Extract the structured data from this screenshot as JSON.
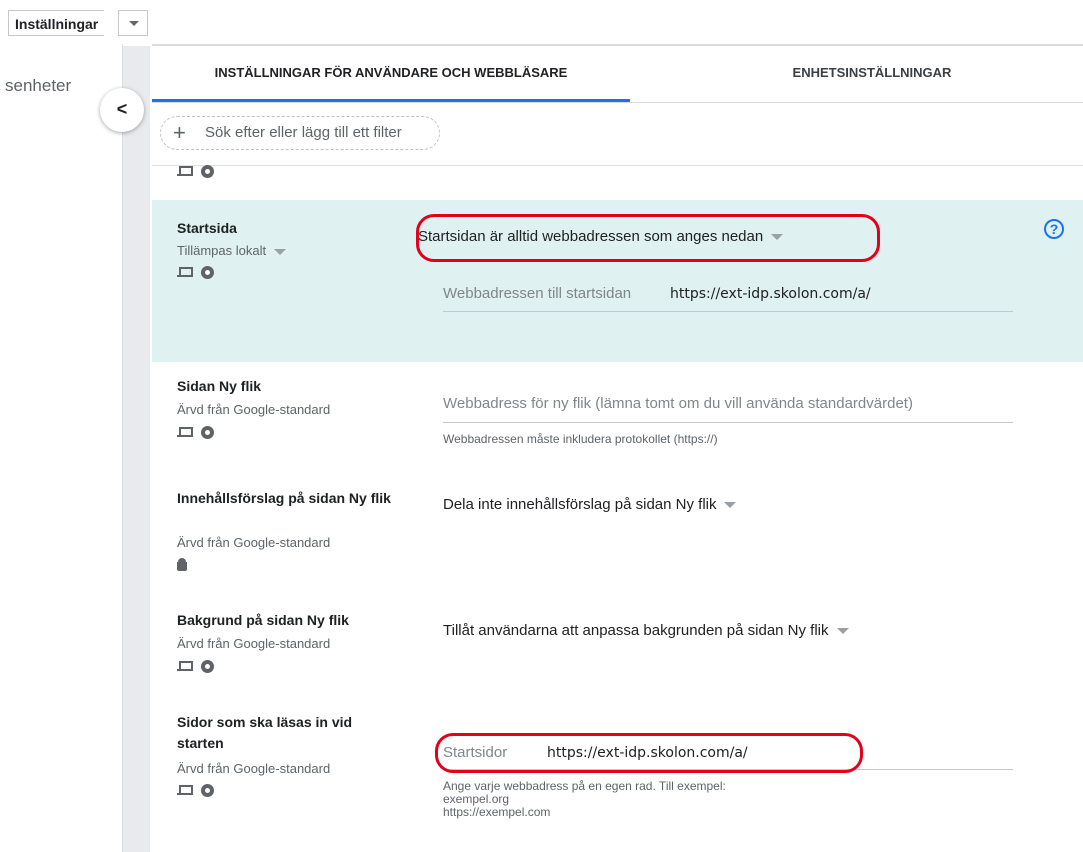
{
  "topbar": {
    "settings_label": "Inställningar"
  },
  "left_rail": {
    "partial_label": "senheter"
  },
  "tabs": [
    {
      "label": "INSTÄLLNINGAR FÖR ANVÄNDARE OCH WEBBLÄSARE",
      "active": true
    },
    {
      "label": "ENHETSINSTÄLLNINGAR",
      "active": false
    }
  ],
  "filter": {
    "placeholder": "Sök efter eller lägg till ett filter"
  },
  "settings": {
    "startsida": {
      "title": "Startsida",
      "source": "Tillämpas lokalt",
      "value": "Startsidan är alltid webbadressen som anges nedan",
      "field_label": "Webbadressen till startsidan",
      "field_value": "https://ext-idp.skolon.com/a/"
    },
    "new_tab": {
      "title": "Sidan Ny flik",
      "source": "Ärvd från Google-standard",
      "placeholder": "Webbadress för ny flik (lämna tomt om du vill använda standardvärdet)",
      "helper": "Webbadressen måste inkludera protokollet (https://)"
    },
    "content_suggestions": {
      "title": "Innehållsförslag på sidan Ny flik",
      "source": "Ärvd från Google-standard",
      "value": "Dela inte innehållsförslag på sidan Ny flik"
    },
    "background": {
      "title": "Bakgrund på sidan Ny flik",
      "source": "Ärvd från Google-standard",
      "value": "Tillåt användarna att anpassa bakgrunden på sidan Ny flik"
    },
    "startup_pages": {
      "title": "Sidor som ska läsas in vid starten",
      "source": "Ärvd från Google-standard",
      "field_label": "Startsidor",
      "field_value": "https://ext-idp.skolon.com/a/",
      "helper_line1": "Ange varje webbadress på en egen rad. Till exempel:",
      "helper_line2": "exempel.org",
      "helper_line3": "https://exempel.com"
    }
  },
  "icons": {
    "help": "help-circle-icon",
    "laptop": "laptop-icon",
    "chrome": "chrome-icon",
    "android": "android-icon"
  },
  "colors": {
    "accent": "#1a73e8",
    "highlight_bg": "#dff1f1",
    "annotation_red": "#e3001b"
  }
}
